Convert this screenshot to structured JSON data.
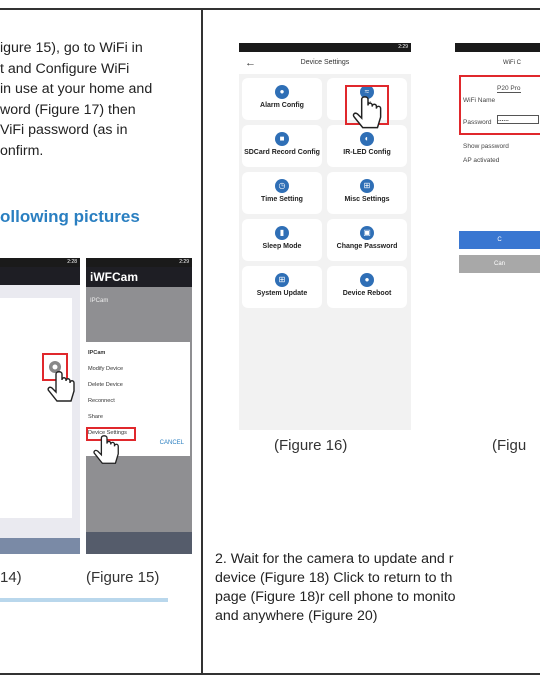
{
  "left": {
    "lines": [
      "igure 15), go to WiFi in",
      "t and Configure WiFi",
      "in use at your home and",
      "word (Figure 17) then",
      "ViFi password (as in",
      "onfirm."
    ],
    "heading": "ollowing pictures",
    "fig14": {
      "caption": "14)",
      "status_time": "2:28"
    },
    "fig15": {
      "app_title": "iWFCam",
      "device_name": "IPCam",
      "menu_title": "IPCam",
      "menu_items": [
        "Modify Device",
        "Delete Device",
        "Reconnect",
        "Share",
        "Device Settings"
      ],
      "cancel": "CANCEL",
      "caption": "(Figure 15)",
      "status_time": "2:29"
    }
  },
  "right": {
    "fig16": {
      "title": "Device Settings",
      "status_time": "2:29",
      "tiles": [
        {
          "label": "Alarm Config",
          "icon": "bell-icon"
        },
        {
          "label": "Wi",
          "icon": "wifi-icon"
        },
        {
          "label": "SDCard Record Config",
          "icon": "sdcard-icon"
        },
        {
          "label": "IR-LED Config",
          "icon": "led-icon"
        },
        {
          "label": "Time Setting",
          "icon": "clock-icon"
        },
        {
          "label": "Misc Settings",
          "icon": "grid-icon"
        },
        {
          "label": "Sleep Mode",
          "icon": "battery-icon"
        },
        {
          "label": "Change Password",
          "icon": "lock-icon"
        },
        {
          "label": "System Update",
          "icon": "update-icon"
        },
        {
          "label": "Device Reboot",
          "icon": "reboot-icon"
        }
      ],
      "caption": "(Figure 16)"
    },
    "fig17": {
      "title": "WiFi C",
      "wifi_name_label": "WiFi Name",
      "wifi_name_value": "P20 Pro",
      "password_label": "Password",
      "password_value": "......",
      "show_password": "Show password",
      "ap_activated": "AP activated",
      "confirm_btn": "C",
      "cancel_btn": "Can",
      "caption": "(Figu"
    },
    "step2_lines": [
      "2. Wait for the camera to update and r",
      "device (Figure 18) Click to return to th",
      "page (Figure 18)r cell phone to monito",
      "and anywhere (Figure 20)"
    ]
  }
}
